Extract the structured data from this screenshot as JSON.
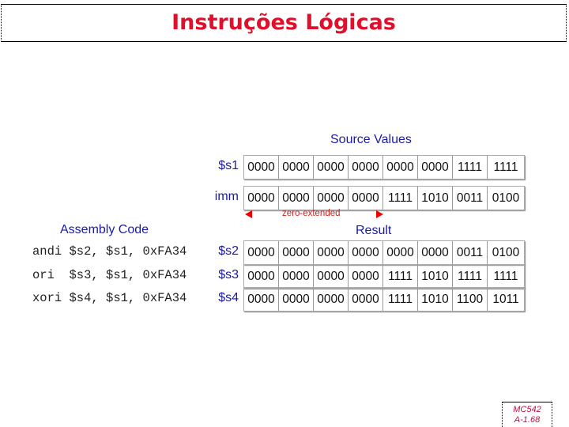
{
  "title": "Instruções Lógicas",
  "source_header": "Source Values",
  "result_header": "Result",
  "assembly_header": "Assembly Code",
  "zero_extended": "zero-extended",
  "source_rows": [
    {
      "label": "$s1",
      "cells": [
        "0000",
        "0000",
        "0000",
        "0000",
        "0000",
        "0000",
        "1111",
        "1111"
      ]
    },
    {
      "label": "imm",
      "cells": [
        "0000",
        "0000",
        "0000",
        "0000",
        "1111",
        "1010",
        "0011",
        "0100"
      ]
    }
  ],
  "result_rows": [
    {
      "label": "$s2",
      "asm": "andi $s2, $s1, 0xFA34",
      "cells": [
        "0000",
        "0000",
        "0000",
        "0000",
        "0000",
        "0000",
        "0011",
        "0100"
      ]
    },
    {
      "label": "$s3",
      "asm": "ori  $s3, $s1, 0xFA34",
      "cells": [
        "0000",
        "0000",
        "0000",
        "0000",
        "1111",
        "1010",
        "1111",
        "1111"
      ]
    },
    {
      "label": "$s4",
      "asm": "xori $s4, $s1, 0xFA34",
      "cells": [
        "0000",
        "0000",
        "0000",
        "0000",
        "1111",
        "1010",
        "1100",
        "1011"
      ]
    }
  ],
  "footer": {
    "course": "MC542",
    "page": "A-1.68"
  }
}
